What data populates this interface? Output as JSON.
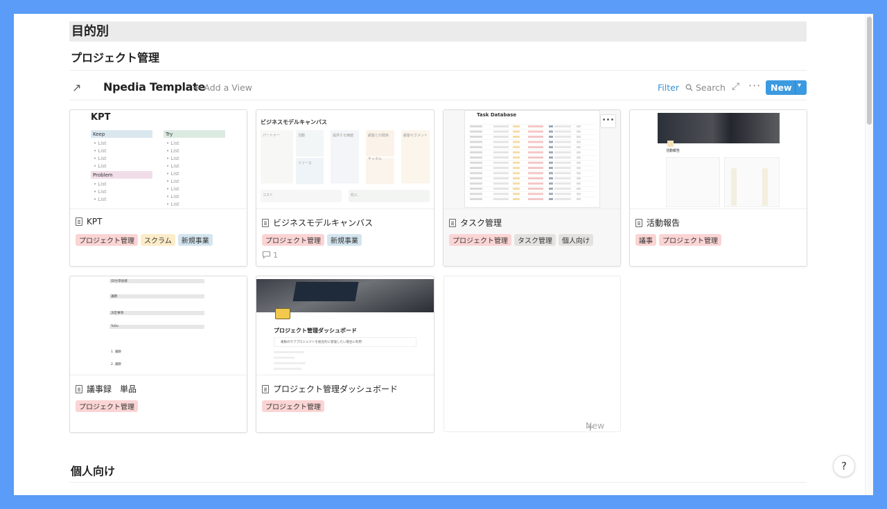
{
  "headings": {
    "section": "目的別",
    "subsection": "プロジェクト管理",
    "next_section": "個人向け"
  },
  "toolbar": {
    "open_icon": "↗",
    "title": "Npedia Template",
    "add_view": "Add a View",
    "filter": "Filter",
    "search": "Search",
    "new_label": "New",
    "expand_icon": "expand-icon",
    "more_icon": "more-icon"
  },
  "colors": {
    "accent": "#3b9ae0",
    "background_frame": "#5a9cf8",
    "tag_red": "#fbd4d4",
    "tag_yellow": "#fdecc8",
    "tag_blue": "#d3e5ef",
    "tag_gray": "#e3e2e0"
  },
  "cards": [
    {
      "title": "KPT",
      "tags": [
        "プロジェクト管理",
        "スクラム",
        "新規事業"
      ],
      "preview": {
        "heading": "KPT",
        "keep": "Keep",
        "try": "Try",
        "problem": "Problem",
        "item": "List"
      }
    },
    {
      "title": "ビジネスモデルキャンバス",
      "tags": [
        "プロジェクト管理",
        "新規事業"
      ],
      "comments": "1",
      "preview": {
        "heading": "ビジネスモデルキャンバス",
        "cells": [
          "パートナー",
          "活動",
          "提供する価値",
          "顧客との関係",
          "顧客セグメント",
          "リソース",
          "チャネル",
          "コスト",
          "収入"
        ]
      }
    },
    {
      "title": "タスク管理",
      "tags": [
        "プロジェクト管理",
        "タスク管理",
        "個人向け"
      ],
      "preview": {
        "heading": "Task Database"
      }
    },
    {
      "title": "活動報告",
      "tags": [
        "議事",
        "プロジェクト管理"
      ],
      "preview": {
        "heading": "活動報告"
      }
    },
    {
      "title": "議事録　単品",
      "tags": [
        "プロジェクト管理"
      ],
      "preview": {
        "rows": [
          "日付/参加者",
          "議題",
          "決定事項",
          "ToDo"
        ],
        "numbered": [
          "1. 議題",
          "2. 議題"
        ]
      }
    },
    {
      "title": "プロジェクト管理ダッシュボード",
      "tags": [
        "プロジェクト管理"
      ],
      "preview": {
        "heading": "プロジェクト管理ダッシュボード",
        "callout": "複数のサブプロジェクトを総合的に管理したい場合に利用"
      }
    }
  ],
  "new_card_label": "New",
  "help_label": "?"
}
